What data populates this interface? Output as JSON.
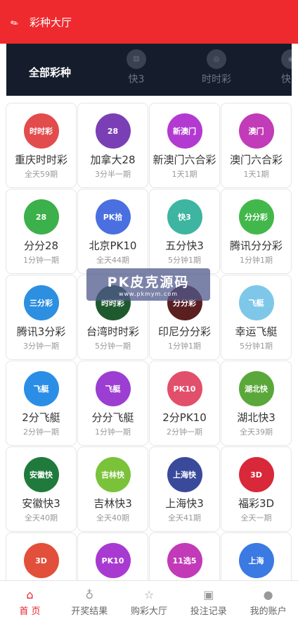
{
  "header": {
    "title": "彩种大厅"
  },
  "categories": {
    "all_label": "全部彩种",
    "items": [
      {
        "label": "快3",
        "icon": "dice-icon"
      },
      {
        "label": "时时彩",
        "icon": "ssc-icon"
      },
      {
        "label": "快乐",
        "icon": "kl-icon"
      }
    ]
  },
  "watermark": {
    "main": "PK皮克源码",
    "sub": "www.pkmym.com"
  },
  "games": [
    {
      "name": "重庆时时彩",
      "freq": "全天59期",
      "color": "#e34c4c",
      "icon_text": "时时彩"
    },
    {
      "name": "加拿大28",
      "freq": "3分半一期",
      "color": "#7b3fb5",
      "icon_text": "28"
    },
    {
      "name": "新澳门六合彩",
      "freq": "1天1期",
      "color": "#b23ad1",
      "icon_text": "新澳门"
    },
    {
      "name": "澳门六合彩",
      "freq": "1天1期",
      "color": "#c23bb8",
      "icon_text": "澳门"
    },
    {
      "name": "分分28",
      "freq": "1分钟一期",
      "color": "#3cb04a",
      "icon_text": "28"
    },
    {
      "name": "北京PK10",
      "freq": "全天44期",
      "color": "#4a6fe0",
      "icon_text": "PK拾"
    },
    {
      "name": "五分快3",
      "freq": "5分钟1期",
      "color": "#3db5a0",
      "icon_text": "快3"
    },
    {
      "name": "腾讯分分彩",
      "freq": "1分钟1期",
      "color": "#42b84a",
      "icon_text": "分分彩"
    },
    {
      "name": "腾讯3分彩",
      "freq": "3分钟一期",
      "color": "#2d8fe0",
      "icon_text": "三分彩"
    },
    {
      "name": "台湾时时彩",
      "freq": "5分钟一期",
      "color": "#1f5a2e",
      "icon_text": "时时彩"
    },
    {
      "name": "印尼分分彩",
      "freq": "1分钟1期",
      "color": "#5a1f1f",
      "icon_text": "分分彩"
    },
    {
      "name": "幸运飞艇",
      "freq": "5分钟1期",
      "color": "#7fc7e8",
      "icon_text": "飞艇"
    },
    {
      "name": "2分飞艇",
      "freq": "2分钟一期",
      "color": "#2b8ee6",
      "icon_text": "飞艇"
    },
    {
      "name": "分分飞艇",
      "freq": "1分钟一期",
      "color": "#9b3ed1",
      "icon_text": "飞艇"
    },
    {
      "name": "2分PK10",
      "freq": "2分钟一期",
      "color": "#e24f6a",
      "icon_text": "PK10"
    },
    {
      "name": "湖北快3",
      "freq": "全天39期",
      "color": "#5aa83a",
      "icon_text": "湖北快"
    },
    {
      "name": "安徽快3",
      "freq": "全天40期",
      "color": "#1f7a3c",
      "icon_text": "安徽快"
    },
    {
      "name": "吉林快3",
      "freq": "全天40期",
      "color": "#7ac23a",
      "icon_text": "吉林快"
    },
    {
      "name": "上海快3",
      "freq": "全天41期",
      "color": "#3a4a9b",
      "icon_text": "上海快"
    },
    {
      "name": "福彩3D",
      "freq": "全天一期",
      "color": "#d8283a",
      "icon_text": "3D"
    },
    {
      "name": "",
      "freq": "",
      "color": "#e24f3a",
      "icon_text": "3D"
    },
    {
      "name": "",
      "freq": "",
      "color": "#a83ad1",
      "icon_text": "PK10"
    },
    {
      "name": "",
      "freq": "",
      "color": "#c23ab8",
      "icon_text": "11选5"
    },
    {
      "name": "",
      "freq": "",
      "color": "#3a7ae2",
      "icon_text": "上海"
    }
  ],
  "tabbar": {
    "items": [
      {
        "label": "首 页",
        "icon": "home-icon",
        "glyph": "⌂",
        "active": true
      },
      {
        "label": "开奖结果",
        "icon": "trophy-icon",
        "glyph": "♁",
        "active": false
      },
      {
        "label": "购彩大厅",
        "icon": "star-icon",
        "glyph": "☆",
        "active": false
      },
      {
        "label": "投注记录",
        "icon": "gift-icon",
        "glyph": "▣",
        "active": false
      },
      {
        "label": "我的账户",
        "icon": "user-icon",
        "glyph": "●",
        "active": false
      }
    ]
  }
}
